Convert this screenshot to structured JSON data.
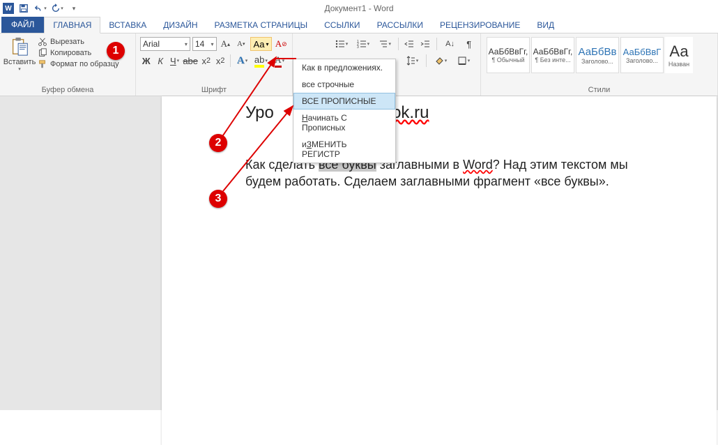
{
  "titlebar": {
    "doc_title": "Документ1 - Word"
  },
  "tabs": {
    "file": "ФАЙЛ",
    "items": [
      "ГЛАВНАЯ",
      "ВСТАВКА",
      "ДИЗАЙН",
      "РАЗМЕТКА СТРАНИЦЫ",
      "ССЫЛКИ",
      "РАССЫЛКИ",
      "РЕЦЕНЗИРОВАНИЕ",
      "ВИД"
    ],
    "active": 0
  },
  "clipboard": {
    "paste": "Вставить",
    "cut": "Вырезать",
    "copy": "Копировать",
    "format_painter": "Формат по образцу",
    "group_label": "Буфер обмена"
  },
  "font": {
    "name": "Arial",
    "size": "14",
    "group_label": "Шрифт",
    "buttons_row2": [
      "Ж",
      "К",
      "Ч",
      "abe",
      "x₂",
      "x²"
    ]
  },
  "paragraph": {
    "group_label": "ац"
  },
  "styles": {
    "group_label": "Стили",
    "items": [
      {
        "preview": "АаБбВвГг,",
        "name": "¶ Обычный"
      },
      {
        "preview": "АаБбВвГг,",
        "name": "¶ Без инте..."
      },
      {
        "preview": "АаБбВв",
        "name": "Заголово..."
      },
      {
        "preview": "АаБбВвГ",
        "name": "Заголово..."
      },
      {
        "preview": "Аа",
        "name": "Назван"
      }
    ]
  },
  "case_menu": {
    "items": [
      "Как в предложениях.",
      "все строчные",
      "ВСЕ ПРОПИСНЫЕ",
      "Начинать С Прописных",
      "иЗМЕНИТЬ РЕГИСТР"
    ],
    "hover": 2
  },
  "document": {
    "heading_pre": "Уро",
    "heading_post": "tapok.ru",
    "body_1": "Как сделать ",
    "body_sel": "все буквы",
    "body_2": " заглавными в ",
    "body_ul": "Word",
    "body_3": "? Над этим текстом мы будем работать. Сделаем заглавными фрагмент «все буквы»."
  },
  "callouts": [
    "1",
    "2",
    "3"
  ]
}
